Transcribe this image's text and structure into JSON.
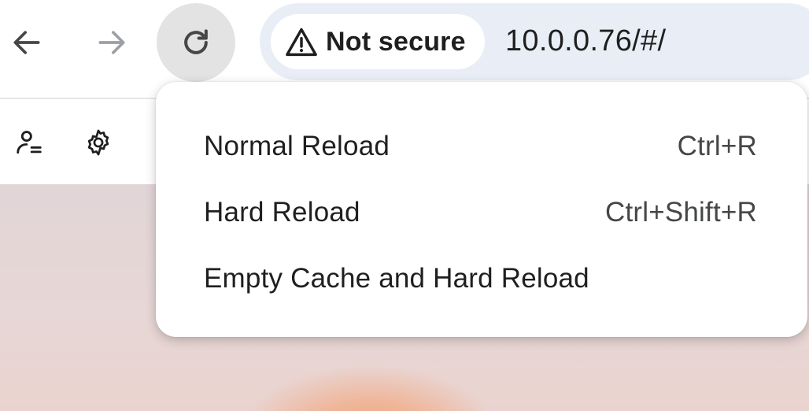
{
  "toolbar": {
    "back_icon": "arrow-left-icon",
    "forward_icon": "arrow-right-icon",
    "reload_icon": "reload-icon",
    "omnibox": {
      "security_label": "Not secure",
      "security_icon": "warning-triangle-icon",
      "url": "10.0.0.76/#/"
    }
  },
  "page_bar": {
    "icons": [
      "user-list-icon",
      "gear-icon"
    ]
  },
  "reload_menu": {
    "items": [
      {
        "label": "Normal Reload",
        "shortcut": "Ctrl+R"
      },
      {
        "label": "Hard Reload",
        "shortcut": "Ctrl+Shift+R"
      },
      {
        "label": "Empty Cache and Hard Reload",
        "shortcut": ""
      }
    ]
  },
  "colors": {
    "omnibox_bg": "#e9eef6",
    "reload_button_bg": "#e3e3e3",
    "text": "#1f1f1f",
    "disabled_icon": "#9aa0a6"
  }
}
